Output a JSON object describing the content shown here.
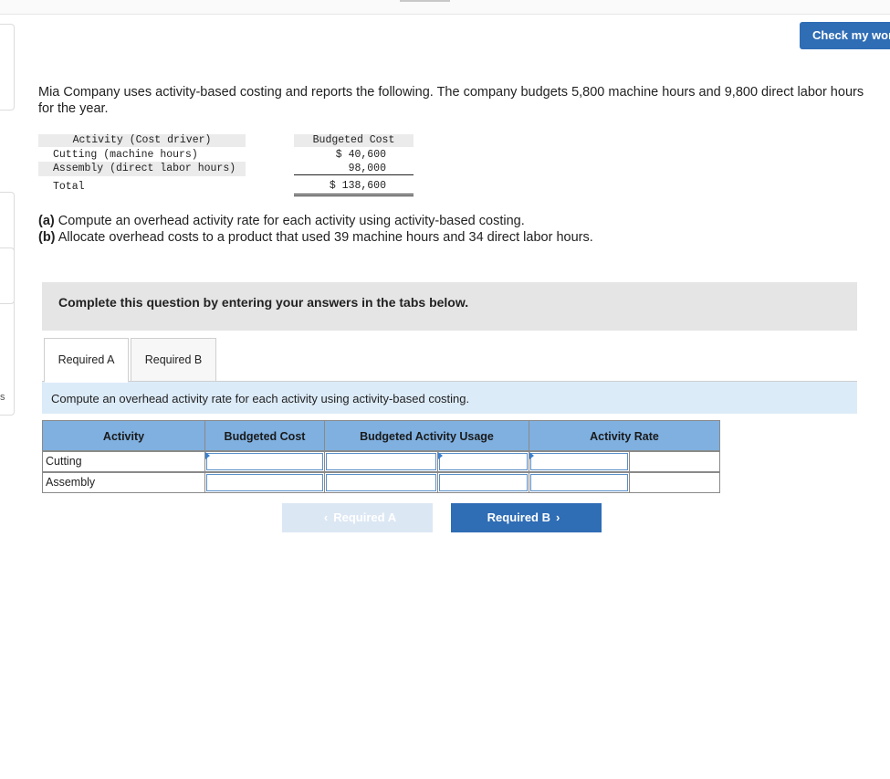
{
  "header": {
    "check_button_label": "Check my work"
  },
  "sidebar": {
    "glyph": "s"
  },
  "problem": {
    "intro": "Mia Company uses activity-based costing and reports the following. The company budgets 5,800 machine hours and 9,800 direct labor hours for the year.",
    "budget_table": {
      "header_activity": "Activity (Cost driver)",
      "header_cost": "Budgeted Cost",
      "rows": [
        {
          "activity": "Cutting (machine hours)",
          "cost": "$ 40,600"
        },
        {
          "activity": "Assembly (direct labor hours)",
          "cost": "98,000"
        }
      ],
      "total_label": "Total",
      "total_value": "$ 138,600"
    },
    "part_a_label": "(a)",
    "part_a_text": " Compute an overhead activity rate for each activity using activity-based costing.",
    "part_b_label": "(b)",
    "part_b_text": " Allocate overhead costs to a product that used 39 machine hours and 34 direct labor hours."
  },
  "banner": {
    "text": "Complete this question by entering your answers in the tabs below."
  },
  "tabs": [
    {
      "label": "Required A",
      "active": true
    },
    {
      "label": "Required B",
      "active": false
    }
  ],
  "instruction": "Compute an overhead activity rate for each activity using activity-based costing.",
  "answer_table": {
    "headers": [
      "Activity",
      "Budgeted Cost",
      "Budgeted Activity Usage",
      "Activity Rate"
    ],
    "rows": [
      {
        "activity": "Cutting",
        "budgeted_cost": "",
        "usage_value": "",
        "usage_unit": "",
        "rate_value": "",
        "rate_unit": ""
      },
      {
        "activity": "Assembly",
        "budgeted_cost": "",
        "usage_value": "",
        "usage_unit": "",
        "rate_value": "",
        "rate_unit": ""
      }
    ]
  },
  "navigation": {
    "prev_label": "Required A",
    "next_label": "Required B",
    "prev_icon": "chevron-left-icon",
    "next_icon": "chevron-right-icon"
  },
  "colors": {
    "primary_button": "#2f6db5",
    "header_cell": "#7fb0e0",
    "instruction_bg": "#dcebf8"
  }
}
